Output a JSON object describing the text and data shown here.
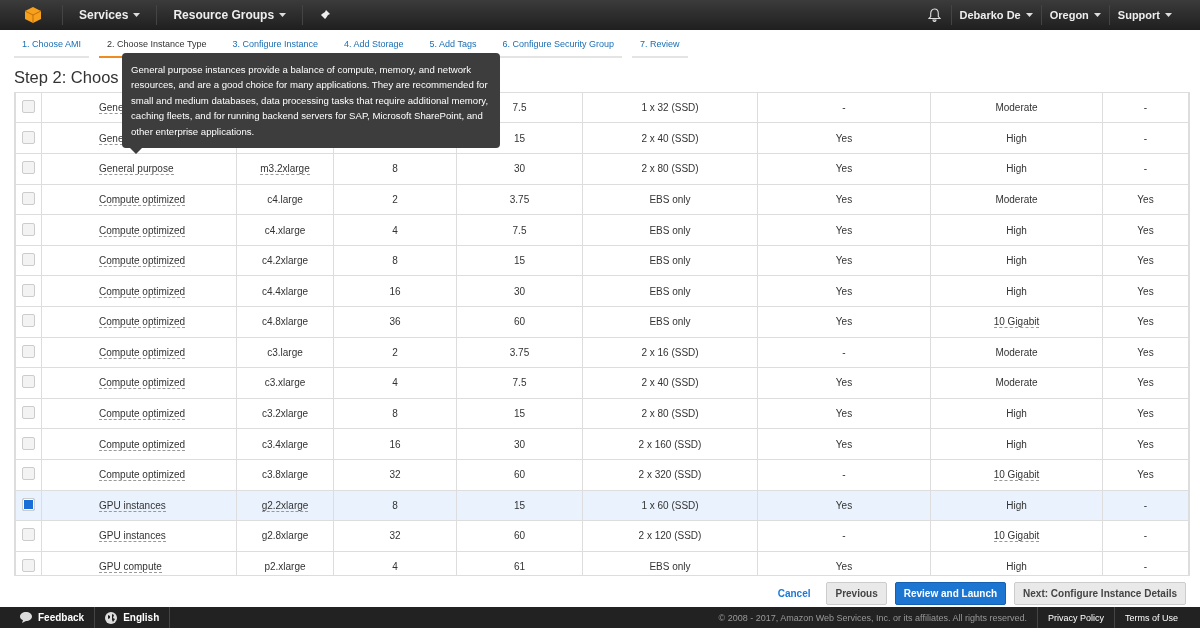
{
  "top_nav": {
    "left": [
      {
        "label": "Services"
      },
      {
        "label": "Resource Groups"
      }
    ],
    "right": [
      {
        "label": "Debarko De"
      },
      {
        "label": "Oregon"
      },
      {
        "label": "Support"
      }
    ]
  },
  "wizard_tabs": [
    {
      "label": "1. Choose AMI",
      "selected": false
    },
    {
      "label": "2. Choose Instance Type",
      "selected": true
    },
    {
      "label": "3. Configure Instance",
      "selected": false
    },
    {
      "label": "4. Add Storage",
      "selected": false
    },
    {
      "label": "5. Add Tags",
      "selected": false
    },
    {
      "label": "6. Configure Security Group",
      "selected": false
    },
    {
      "label": "7. Review",
      "selected": false
    }
  ],
  "heading": "Step 2: Choos",
  "tooltip": "General purpose instances provide a balance of compute, memory, and network resources, and are a good choice for many applications. They are recommended for small and medium databases, data processing tasks that require additional memory, caching fleets, and for running backend servers for SAP, Microsoft SharePoint, and other enterprise applications.",
  "rows": [
    {
      "selected": false,
      "family": "Gene",
      "type": "",
      "vcpus": "",
      "memory": "7.5",
      "storage": "1 x 32 (SSD)",
      "ebs": "-",
      "network": "Moderate",
      "ipv6": "-"
    },
    {
      "selected": false,
      "family": "Gene",
      "type": "",
      "vcpus": "",
      "memory": "15",
      "storage": "2 x 40 (SSD)",
      "ebs": "Yes",
      "network": "High",
      "ipv6": "-"
    },
    {
      "selected": false,
      "family": "General purpose",
      "type": "m3.2xlarge",
      "type_hint": true,
      "vcpus": "8",
      "memory": "30",
      "storage": "2 x 80 (SSD)",
      "ebs": "Yes",
      "network": "High",
      "ipv6": "-"
    },
    {
      "selected": false,
      "family": "Compute optimized",
      "type": "c4.large",
      "vcpus": "2",
      "memory": "3.75",
      "storage": "EBS only",
      "ebs": "Yes",
      "network": "Moderate",
      "ipv6": "Yes"
    },
    {
      "selected": false,
      "family": "Compute optimized",
      "type": "c4.xlarge",
      "vcpus": "4",
      "memory": "7.5",
      "storage": "EBS only",
      "ebs": "Yes",
      "network": "High",
      "ipv6": "Yes"
    },
    {
      "selected": false,
      "family": "Compute optimized",
      "type": "c4.2xlarge",
      "vcpus": "8",
      "memory": "15",
      "storage": "EBS only",
      "ebs": "Yes",
      "network": "High",
      "ipv6": "Yes"
    },
    {
      "selected": false,
      "family": "Compute optimized",
      "type": "c4.4xlarge",
      "vcpus": "16",
      "memory": "30",
      "storage": "EBS only",
      "ebs": "Yes",
      "network": "High",
      "ipv6": "Yes"
    },
    {
      "selected": false,
      "family": "Compute optimized",
      "type": "c4.8xlarge",
      "vcpus": "36",
      "memory": "60",
      "storage": "EBS only",
      "ebs": "Yes",
      "network": "10 Gigabit",
      "network_hint": true,
      "ipv6": "Yes"
    },
    {
      "selected": false,
      "family": "Compute optimized",
      "type": "c3.large",
      "vcpus": "2",
      "memory": "3.75",
      "storage": "2 x 16 (SSD)",
      "ebs": "-",
      "network": "Moderate",
      "ipv6": "Yes"
    },
    {
      "selected": false,
      "family": "Compute optimized",
      "type": "c3.xlarge",
      "vcpus": "4",
      "memory": "7.5",
      "storage": "2 x 40 (SSD)",
      "ebs": "Yes",
      "network": "Moderate",
      "ipv6": "Yes"
    },
    {
      "selected": false,
      "family": "Compute optimized",
      "type": "c3.2xlarge",
      "vcpus": "8",
      "memory": "15",
      "storage": "2 x 80 (SSD)",
      "ebs": "Yes",
      "network": "High",
      "ipv6": "Yes"
    },
    {
      "selected": false,
      "family": "Compute optimized",
      "type": "c3.4xlarge",
      "vcpus": "16",
      "memory": "30",
      "storage": "2 x 160 (SSD)",
      "ebs": "Yes",
      "network": "High",
      "ipv6": "Yes"
    },
    {
      "selected": false,
      "family": "Compute optimized",
      "type": "c3.8xlarge",
      "vcpus": "32",
      "memory": "60",
      "storage": "2 x 320 (SSD)",
      "ebs": "-",
      "network": "10 Gigabit",
      "network_hint": true,
      "ipv6": "Yes"
    },
    {
      "selected": true,
      "family": "GPU instances",
      "type": "g2.2xlarge",
      "type_hint": true,
      "vcpus": "8",
      "memory": "15",
      "storage": "1 x 60 (SSD)",
      "ebs": "Yes",
      "network": "High",
      "ipv6": "-"
    },
    {
      "selected": false,
      "family": "GPU instances",
      "type": "g2.8xlarge",
      "vcpus": "32",
      "memory": "60",
      "storage": "2 x 120 (SSD)",
      "ebs": "-",
      "network": "10 Gigabit",
      "network_hint": true,
      "ipv6": "-"
    },
    {
      "selected": false,
      "family": "GPU compute",
      "type": "p2.xlarge",
      "vcpus": "4",
      "memory": "61",
      "storage": "EBS only",
      "ebs": "Yes",
      "network": "High",
      "ipv6": "-"
    }
  ],
  "actions": [
    {
      "label": "Cancel",
      "kind": "link"
    },
    {
      "label": "Previous",
      "kind": "secondary"
    },
    {
      "label": "Review and Launch",
      "kind": "primary"
    },
    {
      "label": "Next: Configure Instance Details",
      "kind": "secondary"
    }
  ],
  "footer": {
    "feedback": "Feedback",
    "language": "English",
    "copyright": "© 2008 - 2017, Amazon Web Services, Inc. or its affiliates. All rights reserved.",
    "links": [
      "Privacy Policy",
      "Terms of Use"
    ]
  }
}
